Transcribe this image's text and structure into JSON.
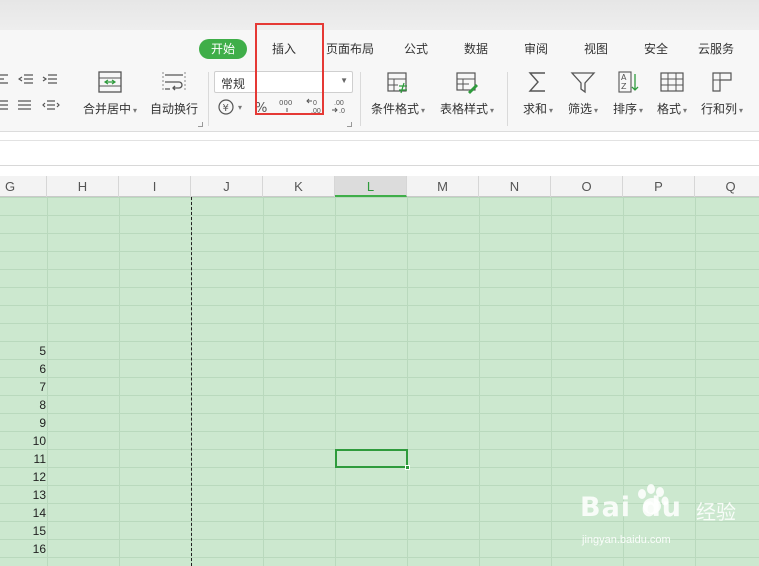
{
  "tabs": [
    {
      "label": "开始",
      "active": true
    },
    {
      "label": "插入",
      "active": false
    },
    {
      "label": "页面布局",
      "active": false
    },
    {
      "label": "公式",
      "active": false
    },
    {
      "label": "数据",
      "active": false
    },
    {
      "label": "审阅",
      "active": false
    },
    {
      "label": "视图",
      "active": false
    },
    {
      "label": "安全",
      "active": false
    },
    {
      "label": "云服务",
      "active": false
    }
  ],
  "ribbon": {
    "merge_center": "合并居中",
    "wrap_text": "自动换行",
    "number_format": "常规",
    "currency_symbol": "¥",
    "percent_symbol": "%",
    "thousands_symbol": "000",
    "conditional_format": "条件格式",
    "table_style": "表格样式",
    "sum": "求和",
    "filter": "筛选",
    "sort": "排序",
    "format": "格式",
    "rows_cols": "行和列"
  },
  "columns": [
    "G",
    "H",
    "I",
    "J",
    "K",
    "L",
    "M",
    "N",
    "O",
    "P",
    "Q"
  ],
  "selected_column": "L",
  "cell_values": [
    "5",
    "6",
    "7",
    "8",
    "9",
    "10",
    "11",
    "12",
    "13",
    "14",
    "15",
    "16"
  ],
  "colors": {
    "accent": "#3fae49",
    "sheet_background": "#cce8cf",
    "highlight_box": "#e53935"
  },
  "watermark": {
    "brand": "Bai du",
    "cn": "经验",
    "url": "jingyan.baidu.com"
  }
}
